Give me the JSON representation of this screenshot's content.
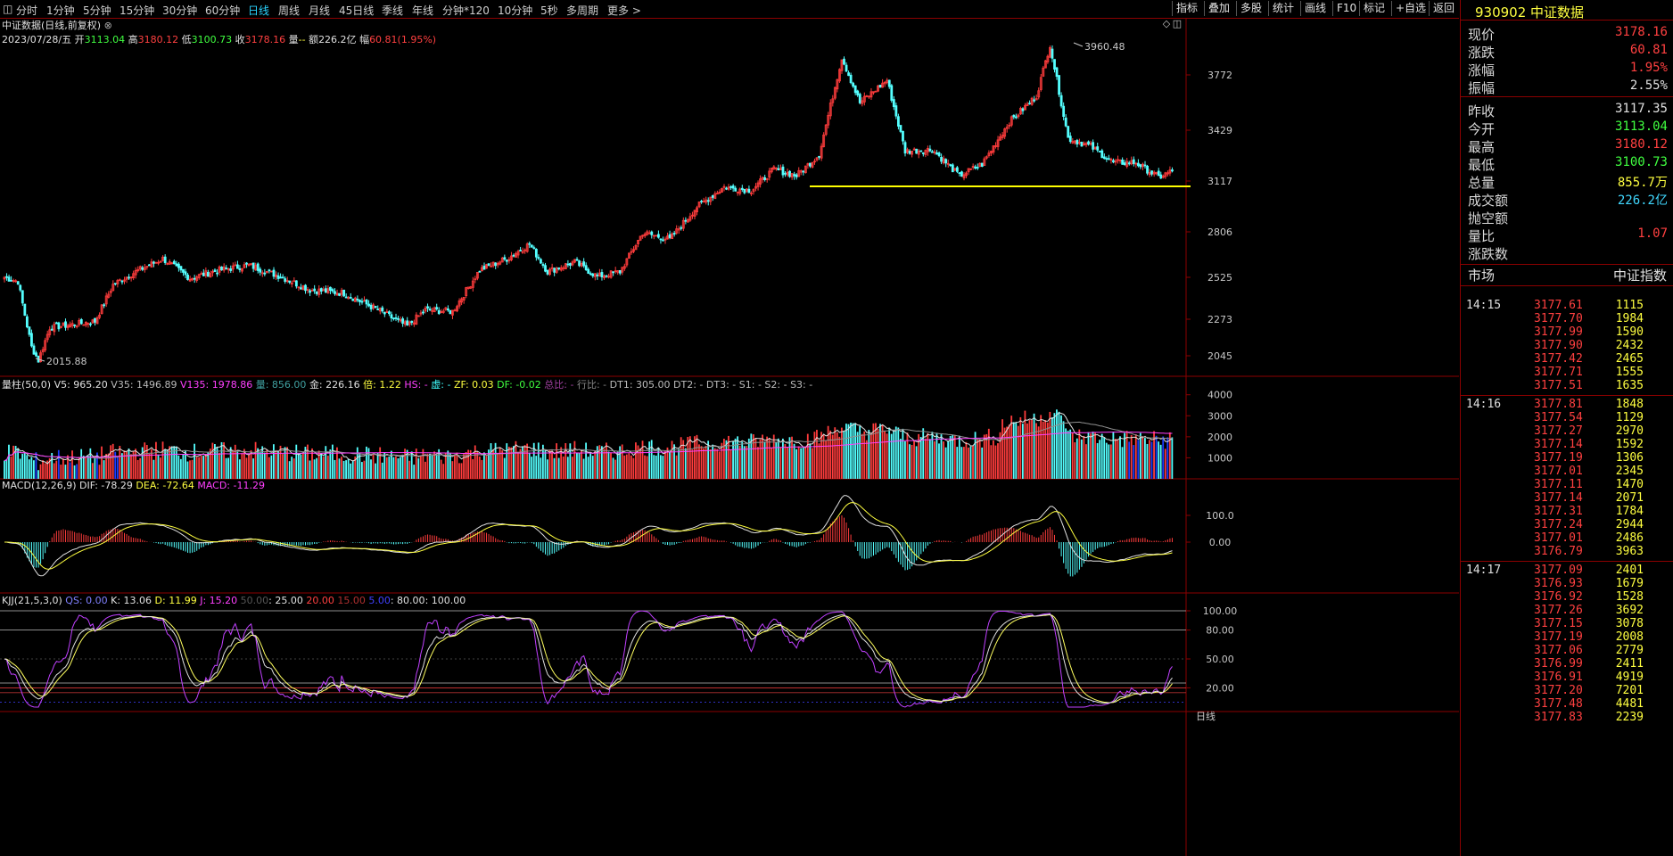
{
  "toolbar": {
    "menu_glyph": "◫",
    "periods": [
      "分时",
      "1分钟",
      "5分钟",
      "15分钟",
      "30分钟",
      "60分钟",
      "日线",
      "周线",
      "月线",
      "45日线",
      "季线",
      "年线",
      "分钟*120",
      "10分钟",
      "5秒",
      "多周期",
      "更多 >"
    ],
    "active_period": "日线",
    "buttons": [
      "指标",
      "叠加",
      "多股",
      "统计",
      "画线",
      "F10",
      "标记",
      "+自选",
      "返回"
    ]
  },
  "header": {
    "title": "中证数据(日线,前复权)",
    "date": "2023/07/28/五",
    "open_label": "开",
    "open": "3113.04",
    "high_label": "高",
    "high": "3180.12",
    "low_label": "低",
    "low": "3100.73",
    "close_label": "收",
    "close": "3178.16",
    "vol_label": "量",
    "vol": "--",
    "amount_label": "额",
    "amount": "226.2亿",
    "change_label": "幅",
    "change": "60.81(1.95%)"
  },
  "volume_header": {
    "name": "量柱(50,0)",
    "v5": "V5: 965.20",
    "v35": "V35: 1496.89",
    "v135": "V135: 1978.86",
    "liang": "量: 856.00",
    "jin": "金: 226.16",
    "bei": "倍: 1.22",
    "hs": "HS: -",
    "xu": "虚: -",
    "zf": "ZF: 0.03",
    "df": "DF: -0.02",
    "zb": "总比: -",
    "hb": "行比: -",
    "dt1": "DT1: 305.00",
    "dt2": "DT2: -",
    "dt3": "DT3: -",
    "s1": "S1: -",
    "s2": "S2: -",
    "s3": "S3: -"
  },
  "macd_header": {
    "name": "MACD(12,26,9)",
    "dif": "DIF: -78.29",
    "dea": "DEA: -72.64",
    "macd": "MACD: -11.29"
  },
  "kdj_header": {
    "name": "KJJ(21,5,3,0)",
    "qs": "QS: 0.00",
    "k": "K: 13.06",
    "d": "D: 11.99",
    "j": "J: 15.20",
    "l50": "50.00",
    "l25": ": 25.00",
    "l20": "20.00",
    "l15": "15.00",
    "l5": "5.00",
    "l80": ": 80.00",
    "l100": ": 100.00"
  },
  "chart_labels": {
    "peak": "3960.48",
    "trough": "2015.88",
    "bottom_tag": "日线"
  },
  "price_axis": [
    "3772",
    "3429",
    "3117",
    "2806",
    "2525",
    "2273",
    "2045"
  ],
  "volume_axis": [
    "4000",
    "3000",
    "2000",
    "1000"
  ],
  "macd_axis": [
    "100.0",
    "0.00"
  ],
  "kdj_axis": [
    "100.00",
    "80.00",
    "50.00",
    "20.00"
  ],
  "colors": {
    "up": "#ff3c3c",
    "down": "#54ffff",
    "support_line": "#ffff00",
    "border": "#8b0000"
  },
  "panel": {
    "code": "930902",
    "name": "中证数据",
    "quotes": [
      {
        "k": "现价",
        "v": "3178.16",
        "c": "#ff4040"
      },
      {
        "k": "涨跌",
        "v": "60.81",
        "c": "#ff4040"
      },
      {
        "k": "涨幅",
        "v": "1.95%",
        "c": "#ff4040"
      },
      {
        "k": "振幅",
        "v": "2.55%",
        "c": "#e0e0e0"
      },
      {
        "k": "昨收",
        "v": "3117.35",
        "c": "#e0e0e0"
      },
      {
        "k": "今开",
        "v": "3113.04",
        "c": "#40ff40"
      },
      {
        "k": "最高",
        "v": "3180.12",
        "c": "#ff4040"
      },
      {
        "k": "最低",
        "v": "3100.73",
        "c": "#40ff40"
      },
      {
        "k": "总量",
        "v": "855.7万",
        "c": "#ffff40"
      },
      {
        "k": "成交额",
        "v": "226.2亿",
        "c": "#40d8ff"
      },
      {
        "k": "抛空额",
        "v": "",
        "c": "#e0e0e0"
      },
      {
        "k": "量比",
        "v": "1.07",
        "c": "#ff4040"
      },
      {
        "k": "涨跌数",
        "v": "",
        "c": "#e0e0e0"
      }
    ],
    "market_label": "市场",
    "market_value": "中证指数",
    "ticks": [
      {
        "t": "14:15",
        "p": "3177.61",
        "q": "1115"
      },
      {
        "t": "",
        "p": "3177.70",
        "q": "1984"
      },
      {
        "t": "",
        "p": "3177.99",
        "q": "1590"
      },
      {
        "t": "",
        "p": "3177.90",
        "q": "2432"
      },
      {
        "t": "",
        "p": "3177.42",
        "q": "2465"
      },
      {
        "t": "",
        "p": "3177.71",
        "q": "1555"
      },
      {
        "t": "",
        "p": "3177.51",
        "q": "1635"
      },
      {
        "t": "14:16",
        "p": "3177.81",
        "q": "1848"
      },
      {
        "t": "",
        "p": "3177.54",
        "q": "1129"
      },
      {
        "t": "",
        "p": "3177.27",
        "q": "2970"
      },
      {
        "t": "",
        "p": "3177.14",
        "q": "1592"
      },
      {
        "t": "",
        "p": "3177.19",
        "q": "1306"
      },
      {
        "t": "",
        "p": "3177.01",
        "q": "2345"
      },
      {
        "t": "",
        "p": "3177.11",
        "q": "1470"
      },
      {
        "t": "",
        "p": "3177.14",
        "q": "2071"
      },
      {
        "t": "",
        "p": "3177.31",
        "q": "1784"
      },
      {
        "t": "",
        "p": "3177.24",
        "q": "2944"
      },
      {
        "t": "",
        "p": "3177.01",
        "q": "2486"
      },
      {
        "t": "",
        "p": "3176.79",
        "q": "3963"
      },
      {
        "t": "14:17",
        "p": "3177.09",
        "q": "2401"
      },
      {
        "t": "",
        "p": "3176.93",
        "q": "1679"
      },
      {
        "t": "",
        "p": "3176.92",
        "q": "1528"
      },
      {
        "t": "",
        "p": "3177.26",
        "q": "3692"
      },
      {
        "t": "",
        "p": "3177.15",
        "q": "3078"
      },
      {
        "t": "",
        "p": "3177.19",
        "q": "2008"
      },
      {
        "t": "",
        "p": "3177.06",
        "q": "2779"
      },
      {
        "t": "",
        "p": "3176.99",
        "q": "2411"
      },
      {
        "t": "",
        "p": "3176.91",
        "q": "4919"
      },
      {
        "t": "",
        "p": "3177.20",
        "q": "7201"
      },
      {
        "t": "",
        "p": "3177.48",
        "q": "4481"
      },
      {
        "t": "",
        "p": "3177.83",
        "q": "2239"
      }
    ]
  },
  "price_path": [
    {
      "i": 0,
      "v": 2525
    },
    {
      "i": 6,
      "v": 2500
    },
    {
      "i": 12,
      "v": 2100
    },
    {
      "i": 15,
      "v": 2015.88
    },
    {
      "i": 20,
      "v": 2220
    },
    {
      "i": 30,
      "v": 2240
    },
    {
      "i": 40,
      "v": 2260
    },
    {
      "i": 48,
      "v": 2480
    },
    {
      "i": 58,
      "v": 2560
    },
    {
      "i": 70,
      "v": 2640
    },
    {
      "i": 82,
      "v": 2520
    },
    {
      "i": 95,
      "v": 2570
    },
    {
      "i": 108,
      "v": 2600
    },
    {
      "i": 122,
      "v": 2530
    },
    {
      "i": 135,
      "v": 2450
    },
    {
      "i": 150,
      "v": 2430
    },
    {
      "i": 165,
      "v": 2330
    },
    {
      "i": 178,
      "v": 2230
    },
    {
      "i": 186,
      "v": 2330
    },
    {
      "i": 198,
      "v": 2320
    },
    {
      "i": 210,
      "v": 2570
    },
    {
      "i": 222,
      "v": 2640
    },
    {
      "i": 232,
      "v": 2730
    },
    {
      "i": 240,
      "v": 2560
    },
    {
      "i": 252,
      "v": 2620
    },
    {
      "i": 262,
      "v": 2530
    },
    {
      "i": 272,
      "v": 2560
    },
    {
      "i": 282,
      "v": 2800
    },
    {
      "i": 294,
      "v": 2760
    },
    {
      "i": 306,
      "v": 2960
    },
    {
      "i": 318,
      "v": 3080
    },
    {
      "i": 330,
      "v": 3060
    },
    {
      "i": 340,
      "v": 3190
    },
    {
      "i": 350,
      "v": 3150
    },
    {
      "i": 360,
      "v": 3280
    },
    {
      "i": 370,
      "v": 3880
    },
    {
      "i": 378,
      "v": 3600
    },
    {
      "i": 390,
      "v": 3740
    },
    {
      "i": 398,
      "v": 3300
    },
    {
      "i": 410,
      "v": 3310
    },
    {
      "i": 422,
      "v": 3150
    },
    {
      "i": 432,
      "v": 3220
    },
    {
      "i": 444,
      "v": 3480
    },
    {
      "i": 456,
      "v": 3640
    },
    {
      "i": 462,
      "v": 3960.48
    },
    {
      "i": 470,
      "v": 3380
    },
    {
      "i": 480,
      "v": 3330
    },
    {
      "i": 490,
      "v": 3230
    },
    {
      "i": 500,
      "v": 3230
    },
    {
      "i": 510,
      "v": 3140
    },
    {
      "i": 516,
      "v": 3178.16
    }
  ],
  "chart_data": {
    "type": "candlestick",
    "title": "中证数据(日线,前复权)",
    "last_bar": {
      "date": "2023/07/28",
      "open": 3113.04,
      "high": 3180.12,
      "low": 3100.73,
      "close": 3178.16,
      "amount": "226.2亿",
      "change": 60.81,
      "change_pct": 1.95
    },
    "annotations": {
      "high": 3960.48,
      "low": 2015.88,
      "support_line": 3100
    },
    "price_axis_ticks": [
      3772,
      3429,
      3117,
      2806,
      2525,
      2273,
      2045
    ],
    "volume_axis_ticks": [
      4000,
      3000,
      2000,
      1000
    ],
    "macd": {
      "dif": -78.29,
      "dea": -72.64,
      "macd": -11.29,
      "axis": [
        100.0,
        0.0
      ]
    },
    "kdj": {
      "k": 13.06,
      "d": 11.99,
      "j": 15.2,
      "levels": [
        100,
        80,
        50,
        25,
        20,
        15,
        5
      ]
    }
  }
}
